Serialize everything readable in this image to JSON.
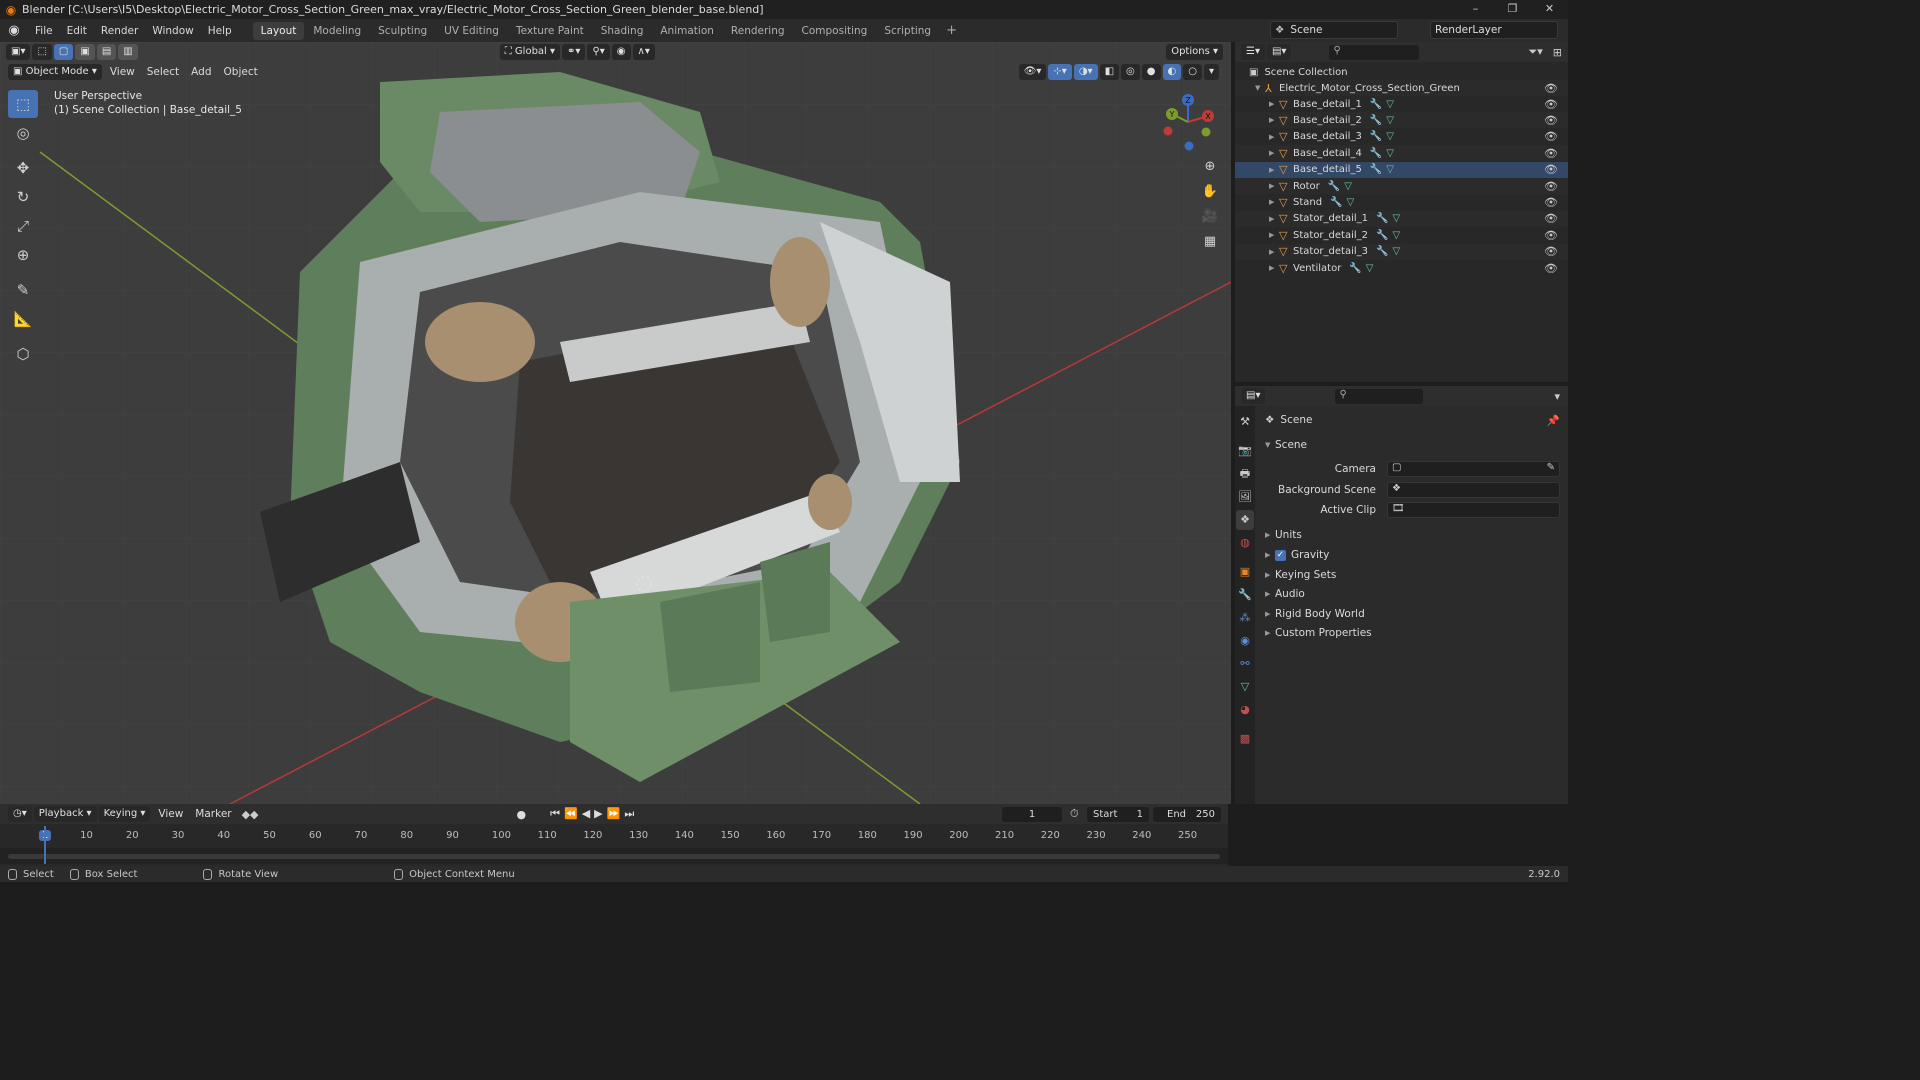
{
  "window": {
    "title": "Blender [C:\\Users\\I5\\Desktop\\Electric_Motor_Cross_Section_Green_max_vray/Electric_Motor_Cross_Section_Green_blender_base.blend]",
    "controls": [
      "–",
      "❐",
      "✕"
    ]
  },
  "menu": [
    "File",
    "Edit",
    "Render",
    "Window",
    "Help"
  ],
  "workspaces": [
    "Layout",
    "Modeling",
    "Sculpting",
    "UV Editing",
    "Texture Paint",
    "Shading",
    "Animation",
    "Rendering",
    "Compositing",
    "Scripting"
  ],
  "active_workspace": "Layout",
  "scene_selector": "Scene",
  "view_layer": "RenderLayer",
  "viewport": {
    "mode": "Object Mode",
    "menus": [
      "View",
      "Select",
      "Add",
      "Object"
    ],
    "transform_orientation": "Global",
    "options_label": "Options",
    "perspective_label": "User Perspective",
    "collection_label": "(1) Scene Collection | Base_detail_5",
    "gizmo_axes": [
      "X",
      "Y",
      "Z"
    ]
  },
  "outliner": {
    "root": "Scene Collection",
    "collection": "Electric_Motor_Cross_Section_Green",
    "objects": [
      "Base_detail_1",
      "Base_detail_2",
      "Base_detail_3",
      "Base_detail_4",
      "Base_detail_5",
      "Rotor",
      "Stand",
      "Stator_detail_1",
      "Stator_detail_2",
      "Stator_detail_3",
      "Ventilator"
    ],
    "active_object": "Base_detail_5"
  },
  "properties": {
    "context": "Scene",
    "panel_title": "Scene",
    "fields": [
      {
        "label": "Camera",
        "value": ""
      },
      {
        "label": "Background Scene",
        "value": ""
      },
      {
        "label": "Active Clip",
        "value": ""
      }
    ],
    "panels": [
      "Units",
      "Gravity",
      "Keying Sets",
      "Audio",
      "Rigid Body World",
      "Custom Properties"
    ],
    "gravity_checked": true
  },
  "timeline": {
    "menus": [
      "Playback",
      "Keying",
      "View",
      "Marker"
    ],
    "current_frame": "1",
    "start_label": "Start",
    "start": "1",
    "end_label": "End",
    "end": "250",
    "ticks": [
      "1",
      "10",
      "20",
      "30",
      "40",
      "50",
      "60",
      "70",
      "80",
      "90",
      "100",
      "110",
      "120",
      "130",
      "140",
      "150",
      "160",
      "170",
      "180",
      "190",
      "200",
      "210",
      "220",
      "230",
      "240",
      "250"
    ]
  },
  "statusbar": {
    "select": "Select",
    "box_select": "Box Select",
    "rotate_view": "Rotate View",
    "context_menu": "Object Context Menu",
    "version": "2.92.0"
  },
  "colors": {
    "accent": "#4772b3",
    "motor_green": "#5f7f5c",
    "x_axis": "#c13a3a",
    "y_axis": "#7d9c2e",
    "object_icon": "#e8a045"
  }
}
